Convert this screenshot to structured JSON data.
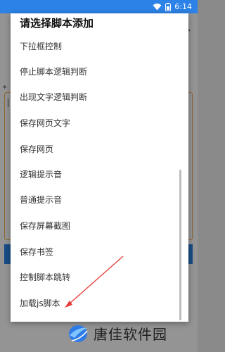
{
  "status_bar": {
    "time": "6:14",
    "icons": [
      "wifi-icon",
      "battery-icon"
    ]
  },
  "background": {
    "required_marker": "*"
  },
  "dialog": {
    "title": "请选择脚本添加",
    "items": [
      {
        "label": "下拉框控制"
      },
      {
        "label": "停止脚本逻辑判断"
      },
      {
        "label": "出现文字逻辑判断"
      },
      {
        "label": "保存网页文字"
      },
      {
        "label": "保存网页"
      },
      {
        "label": "逻辑提示音"
      },
      {
        "label": "普通提示音"
      },
      {
        "label": "保存屏幕截图"
      },
      {
        "label": "保存书签"
      },
      {
        "label": "控制脚本跳转"
      },
      {
        "label": "加载js脚本"
      }
    ]
  },
  "watermark": {
    "text": "唐佳软件园"
  },
  "colors": {
    "status_bar": "#2c82e6",
    "accent_border": "#f0b45a",
    "annotation": "#e53935"
  }
}
